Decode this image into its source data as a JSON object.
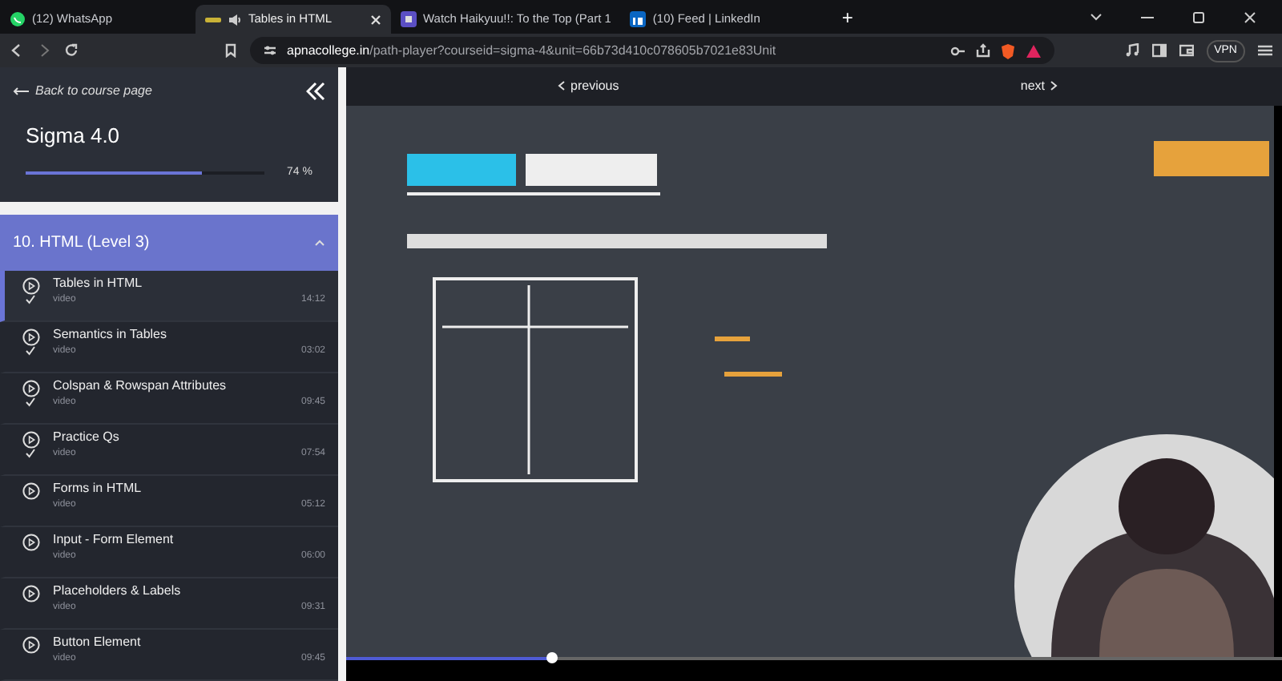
{
  "browser": {
    "tabs": [
      {
        "title": "(12) WhatsApp",
        "selected": false,
        "audio": false,
        "closable": false
      },
      {
        "title": "Tables in HTML",
        "selected": true,
        "audio": true,
        "closable": true
      },
      {
        "title": "Watch Haikyuu!!: To the Top (Part 1",
        "selected": false,
        "audio": false,
        "closable": false
      },
      {
        "title": "(10) Feed | LinkedIn",
        "selected": false,
        "audio": false,
        "closable": false
      }
    ],
    "new_tab": "+",
    "address": {
      "host": "apnacollege.in",
      "path": "/path-player?courseid=sigma-4&unit=66b73d410c078605b7021e83Unit"
    },
    "vpn": "VPN"
  },
  "sidebar": {
    "back_link": "Back to course page",
    "course_title": "Sigma 4.0",
    "progress": {
      "level": 0.74,
      "reading": "74 %"
    },
    "module": {
      "title": "10. HTML (Level 3)",
      "expanded": true,
      "lessons": [
        {
          "title": "Tables in HTML",
          "type": "video",
          "duration": "14:12",
          "completed": true,
          "selected": true
        },
        {
          "title": "Semantics in Tables",
          "type": "video",
          "duration": "03:02",
          "completed": true,
          "selected": false
        },
        {
          "title": "Colspan & Rowspan Attributes",
          "type": "video",
          "duration": "09:45",
          "completed": true,
          "selected": false
        },
        {
          "title": "Practice Qs",
          "type": "video",
          "duration": "07:54",
          "completed": true,
          "selected": false
        },
        {
          "title": "Forms in HTML",
          "type": "video",
          "duration": "05:12",
          "completed": false,
          "selected": false
        },
        {
          "title": "Input - Form Element",
          "type": "video",
          "duration": "06:00",
          "completed": false,
          "selected": false
        },
        {
          "title": "Placeholders & Labels",
          "type": "video",
          "duration": "09:31",
          "completed": false,
          "selected": false
        },
        {
          "title": "Button Element",
          "type": "video",
          "duration": "09:45",
          "completed": false,
          "selected": false
        }
      ]
    }
  },
  "player": {
    "previous": "previous",
    "next": "next",
    "video": {
      "kind": "picture",
      "level": 0.22
    }
  }
}
